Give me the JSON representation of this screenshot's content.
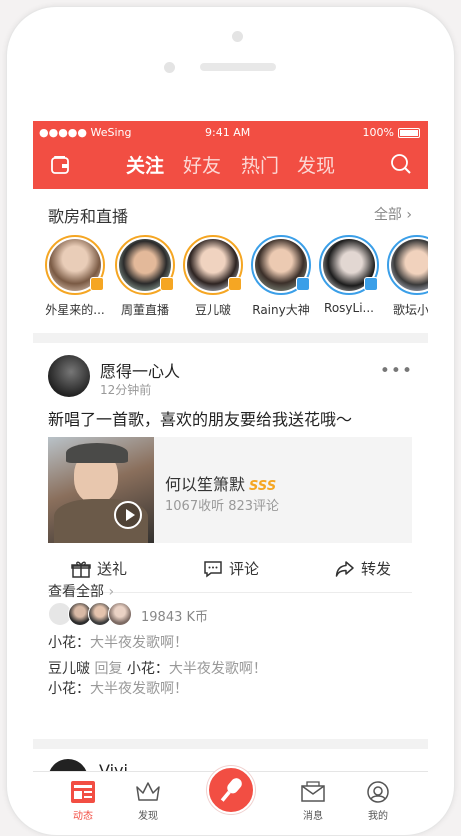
{
  "status": {
    "carrier": "●●●●● WeSing",
    "time": "9:41 AM",
    "battery": "100%"
  },
  "tabs": [
    "关注",
    "好友",
    "热门",
    "发现"
  ],
  "live_section": {
    "title": "歌房和直播",
    "all_label": "全部"
  },
  "live_items": [
    {
      "name": "外星来的..."
    },
    {
      "name": "周董直播"
    },
    {
      "name": "豆儿啵"
    },
    {
      "name": "Rainy大神"
    },
    {
      "name": "RosyLi..."
    },
    {
      "name": "歌坛小哪"
    }
  ],
  "post": {
    "username": "愿得一心人",
    "time": "12分钟前",
    "text": "新唱了一首歌，喜欢的朋友要给我送花哦～",
    "song_title": "何以笙箫默",
    "song_badge": "SSS",
    "song_meta": "1067收听  823评论",
    "actions": {
      "gift": "送礼",
      "comment": "评论",
      "share": "转发"
    },
    "gift_total": "19843 K币",
    "comments": [
      {
        "user": "小花：",
        "text": "大半夜发歌啊！"
      },
      {
        "user": "豆儿啵",
        "reply": "回复",
        "to": "小花：",
        "text": "大半夜发歌啊！"
      },
      {
        "user": "小花：",
        "text": "大半夜发歌啊！"
      }
    ],
    "see_all": "查看全部"
  },
  "next_post": {
    "username": "Vivi"
  },
  "tabbar": [
    "动态",
    "发现",
    "消息",
    "我的"
  ],
  "colors": {
    "brand": "#f24e43",
    "gold": "#f5a623",
    "blue": "#3b9fe8"
  }
}
